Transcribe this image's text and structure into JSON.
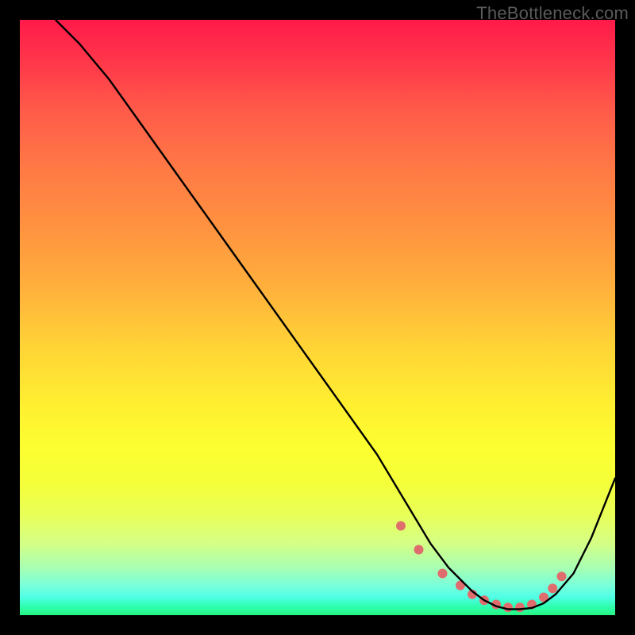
{
  "watermark": "TheBottleneck.com",
  "chart_data": {
    "type": "line",
    "title": "",
    "xlabel": "",
    "ylabel": "",
    "xlim": [
      0,
      100
    ],
    "ylim": [
      0,
      100
    ],
    "grid": false,
    "legend": false,
    "series": [
      {
        "name": "bottleneck-curve",
        "color": "#000000",
        "x": [
          6,
          10,
          15,
          20,
          25,
          30,
          35,
          40,
          45,
          50,
          55,
          60,
          63,
          66,
          69,
          72,
          74,
          76,
          78,
          80,
          82,
          84,
          86,
          88,
          90,
          93,
          96,
          100
        ],
        "y": [
          100,
          96,
          90,
          83,
          76,
          69,
          62,
          55,
          48,
          41,
          34,
          27,
          22,
          17,
          12,
          8,
          6,
          4,
          2.5,
          1.5,
          1,
          1,
          1.2,
          2,
          3.5,
          7,
          13,
          23
        ]
      }
    ],
    "markers": [
      {
        "name": "recommended-range-dots",
        "shape": "circle",
        "color": "#e06d6d",
        "radius_px": 6,
        "x": [
          64,
          67,
          71,
          74,
          76,
          78,
          80,
          82,
          84,
          86,
          88,
          89.5,
          91
        ],
        "y": [
          15,
          11,
          7,
          5,
          3.5,
          2.5,
          1.8,
          1.3,
          1.3,
          1.8,
          3,
          4.5,
          6.5
        ]
      }
    ]
  }
}
